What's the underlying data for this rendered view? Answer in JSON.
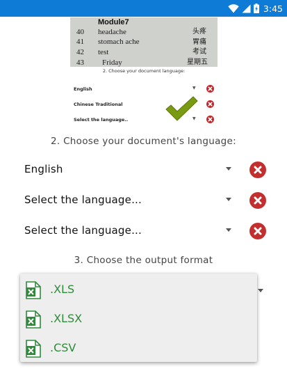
{
  "status_bar": {
    "time": "3:45",
    "background": "#0e7cd6"
  },
  "preview": {
    "sheet_header": "Module7",
    "rows": [
      {
        "num": "40",
        "english": "headache",
        "chinese": "头疼"
      },
      {
        "num": "41",
        "english": "stomach ache",
        "chinese": "胃痛"
      },
      {
        "num": "42",
        "english": "test",
        "chinese": "考试"
      },
      {
        "num": "43",
        "english": "Friday",
        "chinese": "星期五"
      }
    ],
    "heading": "2. Choose your document language:",
    "languages": [
      "English",
      "Chinese Traditional",
      "Select the language.."
    ]
  },
  "language_section": {
    "heading": "2. Choose your document's language:",
    "rows": [
      {
        "label": "English"
      },
      {
        "label": "Select the language..."
      },
      {
        "label": "Select the language..."
      }
    ]
  },
  "format_section": {
    "heading": "3. Choose the output format",
    "options": [
      ".XLS",
      ".XLSX",
      ".CSV"
    ],
    "option_color": "#2d8b3a"
  },
  "icons": {
    "wifi": "wifi-icon",
    "signal": "cellular-signal-icon",
    "battery": "battery-charging-icon",
    "remove": "remove-circle-icon",
    "excel": "excel-file-icon",
    "check": "checkmark-icon",
    "dropdown": "dropdown-arrow-icon"
  },
  "colors": {
    "remove": "#c22f2e",
    "check": "#7a9a12"
  }
}
